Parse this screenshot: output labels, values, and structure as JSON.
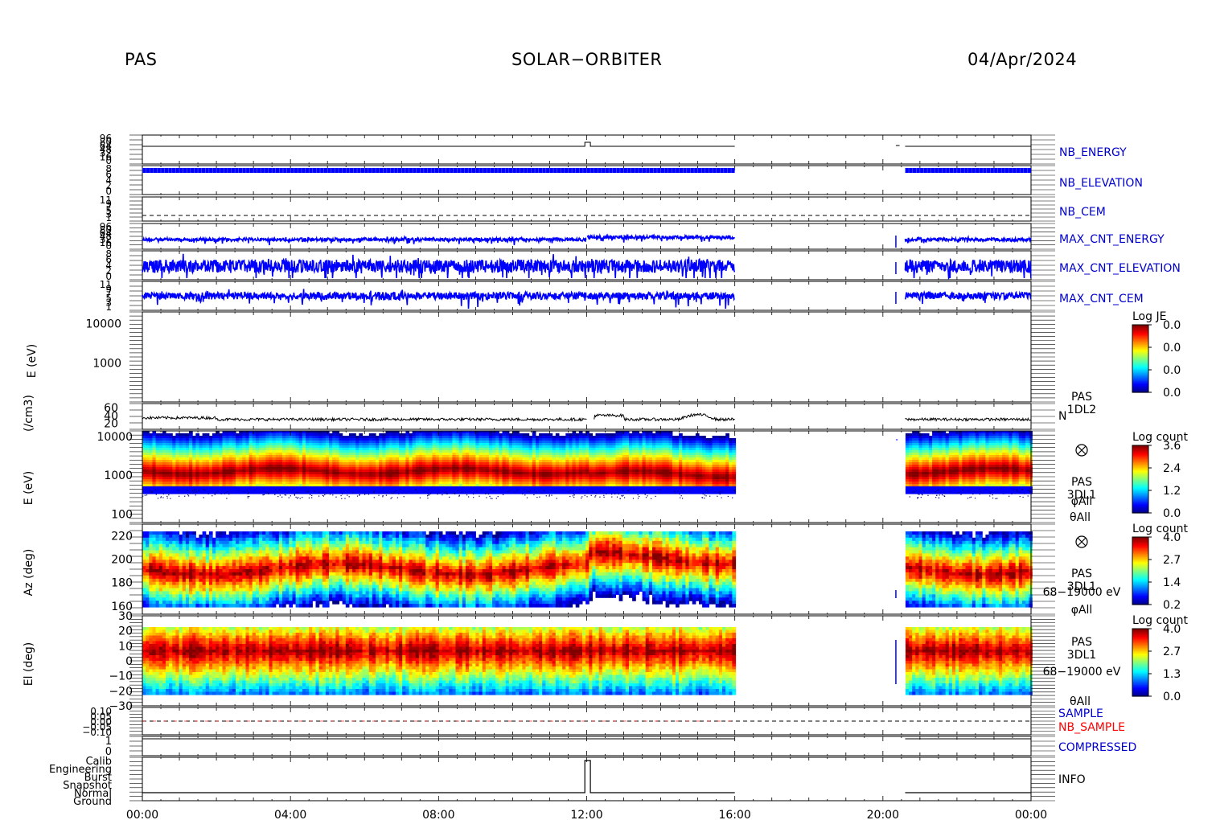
{
  "header": {
    "left": "PAS",
    "center": "SOLAR−ORBITER",
    "right": "04/Apr/2024"
  },
  "colors": {
    "trace_blue": "#0000ff",
    "trace_black": "#000000",
    "label_blue": "#0000cc",
    "label_red": "#ff0000"
  },
  "chart_data": {
    "type": "heatmap",
    "x_axis": {
      "range": [
        "00:00",
        "24:00"
      ],
      "tick_labels": [
        "00:00",
        "04:00",
        "08:00",
        "12:00",
        "16:00",
        "20:00",
        "00:00"
      ],
      "tick_hours": [
        0,
        4,
        8,
        12,
        16,
        20,
        24
      ]
    },
    "data_gaps_hours": [
      [
        16.0,
        20.6
      ]
    ],
    "panels": [
      {
        "id": "nb-energy",
        "type": "line",
        "label": "NB_ENERGY",
        "label_color": "#0000cc",
        "trace_color": "#000000",
        "tick_labels": [
          "96",
          "80",
          "64",
          "48",
          "32",
          "16",
          "0"
        ]
      },
      {
        "id": "nb-elevation",
        "type": "line",
        "label": "NB_ELEVATION",
        "label_color": "#0000cc",
        "trace_color": "#0000ff",
        "tick_labels": [
          "8",
          "6",
          "4",
          "2",
          "0"
        ]
      },
      {
        "id": "nb-cem",
        "type": "line",
        "label": "NB_CEM",
        "label_color": "#0000cc",
        "trace_color": "#000000",
        "tick_labels": [
          "11",
          "9",
          "7",
          "5",
          "3",
          "1"
        ]
      },
      {
        "id": "max-cnt-energy",
        "type": "line",
        "label": "MAX_CNT_ENERGY",
        "label_color": "#0000cc",
        "trace_color": "#0000ff",
        "tick_labels": [
          "96",
          "80",
          "64",
          "48",
          "32",
          "16",
          "0"
        ]
      },
      {
        "id": "max-cnt-elevation",
        "type": "line",
        "label": "MAX_CNT_ELEVATION",
        "label_color": "#0000cc",
        "trace_color": "#0000ff",
        "tick_labels": [
          "8",
          "6",
          "4",
          "2",
          "0"
        ]
      },
      {
        "id": "max-cnt-cem",
        "type": "line",
        "label": "MAX_CNT_CEM",
        "label_color": "#0000cc",
        "trace_color": "#0000ff",
        "tick_labels": [
          "11",
          "9",
          "7",
          "5",
          "3",
          "1"
        ]
      },
      {
        "id": "je-spectrogram",
        "type": "heatmap",
        "ylabel": "E (eV)",
        "scale": "log",
        "y_tick_labels": [
          "10000",
          "1000"
        ],
        "y_tick_values": [
          10000,
          1000
        ],
        "ylim": [
          100,
          20000
        ],
        "colorbar": {
          "title": "Log JE",
          "tick_labels": [
            "0.0",
            "0.0",
            "0.0",
            "0.0"
          ]
        }
      },
      {
        "id": "density",
        "type": "line",
        "ylabel": "(/cm3)",
        "trace_color": "#000000",
        "y_tick_labels": [
          "60",
          "40",
          "20"
        ],
        "y_tick_values": [
          60,
          40,
          20
        ],
        "ylim": [
          5,
          70
        ],
        "side_labels": [
          "PAS",
          "1DL2",
          "N"
        ],
        "baseline": 30
      },
      {
        "id": "energy-spectrogram",
        "type": "heatmap",
        "ylabel": "E (eV)",
        "scale": "log",
        "y_tick_labels": [
          "10000",
          "1000",
          "100"
        ],
        "y_tick_values": [
          10000,
          1000,
          100
        ],
        "ylim": [
          60,
          14000
        ],
        "peak_energy_ev": 2000,
        "colorbar": {
          "title": "Log count",
          "tick_labels": [
            "3.6",
            "2.4",
            "1.2",
            "0.0"
          ],
          "range": [
            0.0,
            3.6
          ]
        },
        "side_labels": [
          "PAS",
          "3DL1",
          "φAll",
          "θAll"
        ]
      },
      {
        "id": "azimuth-spectrogram",
        "type": "heatmap",
        "ylabel": "Az (deg)",
        "y_tick_labels": [
          "220",
          "200",
          "180",
          "160"
        ],
        "y_tick_values": [
          220,
          200,
          180,
          160
        ],
        "ylim": [
          153,
          230
        ],
        "peak_az_deg": 188,
        "colorbar": {
          "title": "Log count",
          "tick_labels": [
            "4.0",
            "2.7",
            "1.4",
            "0.2"
          ],
          "range": [
            0.2,
            4.0
          ]
        },
        "side_labels": [
          "PAS",
          "3DL1",
          "68−19000 eV",
          "φAll"
        ]
      },
      {
        "id": "elevation-spectrogram",
        "type": "heatmap",
        "ylabel": "El (deg)",
        "y_tick_labels": [
          "30",
          "20",
          "10",
          "0",
          "−10",
          "−20",
          "−30"
        ],
        "y_tick_values": [
          30,
          20,
          10,
          0,
          -10,
          -20,
          -30
        ],
        "ylim": [
          -30,
          30
        ],
        "peak_el_deg": 4,
        "colorbar": {
          "title": "Log count",
          "tick_labels": [
            "4.0",
            "2.7",
            "1.3",
            "0.0"
          ],
          "range": [
            0.0,
            4.0
          ]
        },
        "side_labels": [
          "PAS",
          "3DL1",
          "68−19000 eV",
          "θAll"
        ]
      },
      {
        "id": "sample",
        "type": "line",
        "labels": [
          {
            "text": "SAMPLE",
            "color": "#0000cc"
          },
          {
            "text": "NB_SAMPLE",
            "color": "#ff0000"
          }
        ],
        "tick_labels": [
          "0.10",
          "0.05",
          "0.00",
          "−0.05",
          "−0.10"
        ]
      },
      {
        "id": "compressed",
        "type": "line",
        "label": "COMPRESSED",
        "label_color": "#0000cc",
        "tick_labels": [
          "1",
          "0"
        ]
      },
      {
        "id": "info",
        "type": "line",
        "label": "INFO",
        "label_color": "#000000",
        "tick_labels": [
          "Calib",
          "Engineering",
          "Burst",
          "Snapshot",
          "Normal",
          "Ground"
        ]
      }
    ]
  }
}
